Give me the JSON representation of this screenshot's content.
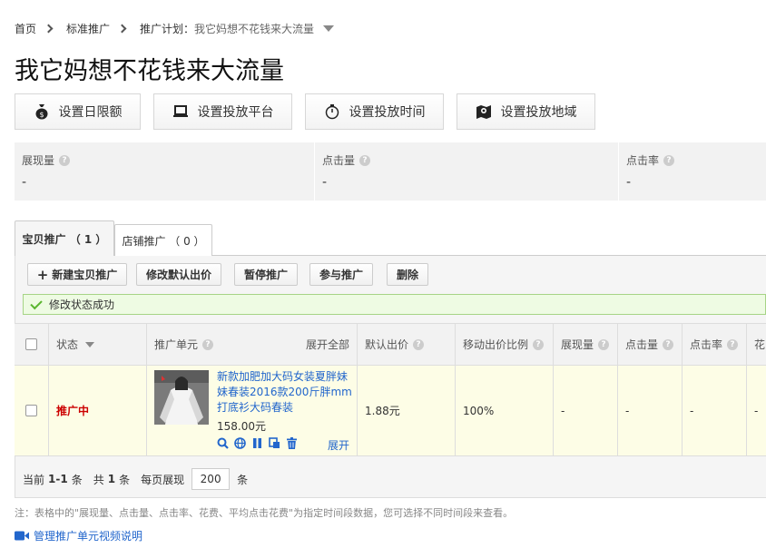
{
  "breadcrumb": {
    "home": "首页",
    "level2": "标准推广",
    "plan_label": "推广计划：",
    "plan_value": "我它妈想不花钱来大流量"
  },
  "page_title": "我它妈想不花钱来大流量",
  "actions": {
    "daily_limit": "设置日限额",
    "platform": "设置投放平台",
    "time": "设置投放时间",
    "region": "设置投放地域"
  },
  "stats": [
    {
      "label": "展现量",
      "value": "-"
    },
    {
      "label": "点击量",
      "value": "-"
    },
    {
      "label": "点击率",
      "value": "-"
    }
  ],
  "tabs": {
    "item_promo": "宝贝推广 （ 1 ）",
    "shop_promo": "店铺推广 （ 0 ）"
  },
  "toolbar": {
    "new_item": "新建宝贝推广",
    "edit_bid": "修改默认出价",
    "pause": "暂停推广",
    "join": "参与推广",
    "delete": "删除"
  },
  "notice": "修改状态成功",
  "table": {
    "headers": {
      "status": "状态",
      "unit": "推广单元",
      "expand_all": "展开全部",
      "default_bid": "默认出价",
      "mobile_ratio": "移动出价比例",
      "impressions": "展现量",
      "clicks": "点击量",
      "ctr": "点击率",
      "cost": "花"
    },
    "row": {
      "status": "推广中",
      "title": "新款加肥加大码女装夏胖妹妹春装2016款200斤胖mm打底衫大码春装",
      "price": "158.00元",
      "expand": "展开",
      "default_bid": "1.88元",
      "mobile_ratio": "100%",
      "impressions": "-",
      "clicks": "-",
      "ctr": "-",
      "cost": "-"
    }
  },
  "pager": {
    "current_prefix": "当前",
    "current_range": "1-1",
    "unit": "条",
    "total_prefix": "共",
    "total": "1",
    "per_page_label": "每页展现",
    "per_page": "200"
  },
  "footnote": "注：表格中的\"展现量、点击量、点击率、花费、平均点击花费\"为指定时间段数据，您可选择不同时间段来查看。",
  "video_link": "管理推广单元视频说明",
  "colors": {
    "link": "#2266cc",
    "status_active": "#cc0000",
    "success_border": "#a6d486"
  }
}
